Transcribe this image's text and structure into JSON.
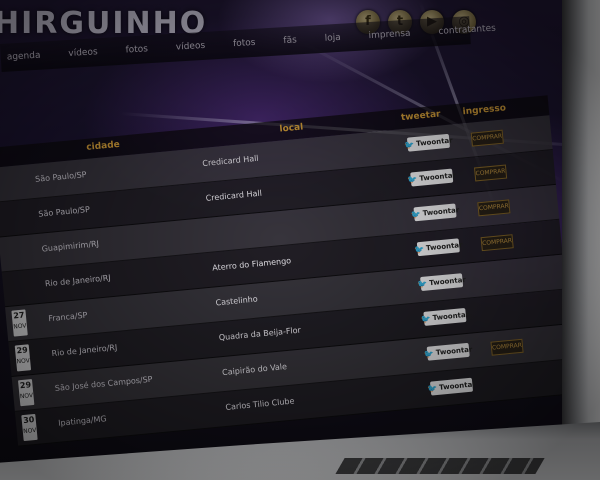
{
  "header": {
    "logo_text": "HIRGUINHO",
    "social_icons": [
      "facebook-icon",
      "twitter-icon",
      "youtube-icon",
      "instagram-icon"
    ],
    "nav_items": [
      "agenda",
      "vídeos",
      "fotos",
      "vídeos",
      "fotos",
      "fãs",
      "loja",
      "imprensa",
      "contratantes"
    ]
  },
  "table": {
    "headers": {
      "cidade": "cidade",
      "local": "local",
      "tweetar": "tweetar",
      "ingresso": "ingresso"
    },
    "tweet_label": "Twoontar",
    "buy_label": "COMPRAR",
    "rows": [
      {
        "day": "",
        "month": "",
        "city": "São Paulo/SP",
        "local": "Credicard Hall",
        "buy": true
      },
      {
        "day": "",
        "month": "",
        "city": "São Paulo/SP",
        "local": "Credicard Hall",
        "buy": true
      },
      {
        "day": "",
        "month": "",
        "city": "Guapimirim/RJ",
        "local": "",
        "buy": true
      },
      {
        "day": "",
        "month": "",
        "city": "Rio de Janeiro/RJ",
        "local": "Aterro do Flamengo",
        "buy": true
      },
      {
        "day": "27",
        "month": "NOV",
        "city": "Franca/SP",
        "local": "Castelinho",
        "buy": false
      },
      {
        "day": "29",
        "month": "NOV",
        "city": "Rio de Janeiro/RJ",
        "local": "Quadra da Beija-Flor",
        "buy": false
      },
      {
        "day": "29",
        "month": "NOV",
        "city": "São José dos Campos/SP",
        "local": "Caipirão do Vale",
        "buy": true
      },
      {
        "day": "30",
        "month": "NOV",
        "city": "Ipatinga/MG",
        "local": "Carlos Tilio Clube",
        "buy": false
      }
    ]
  },
  "colors": {
    "accent_gold": "#d9a23a",
    "twitter_blue": "#2aa3ef",
    "background_purple": "#241a3a"
  }
}
